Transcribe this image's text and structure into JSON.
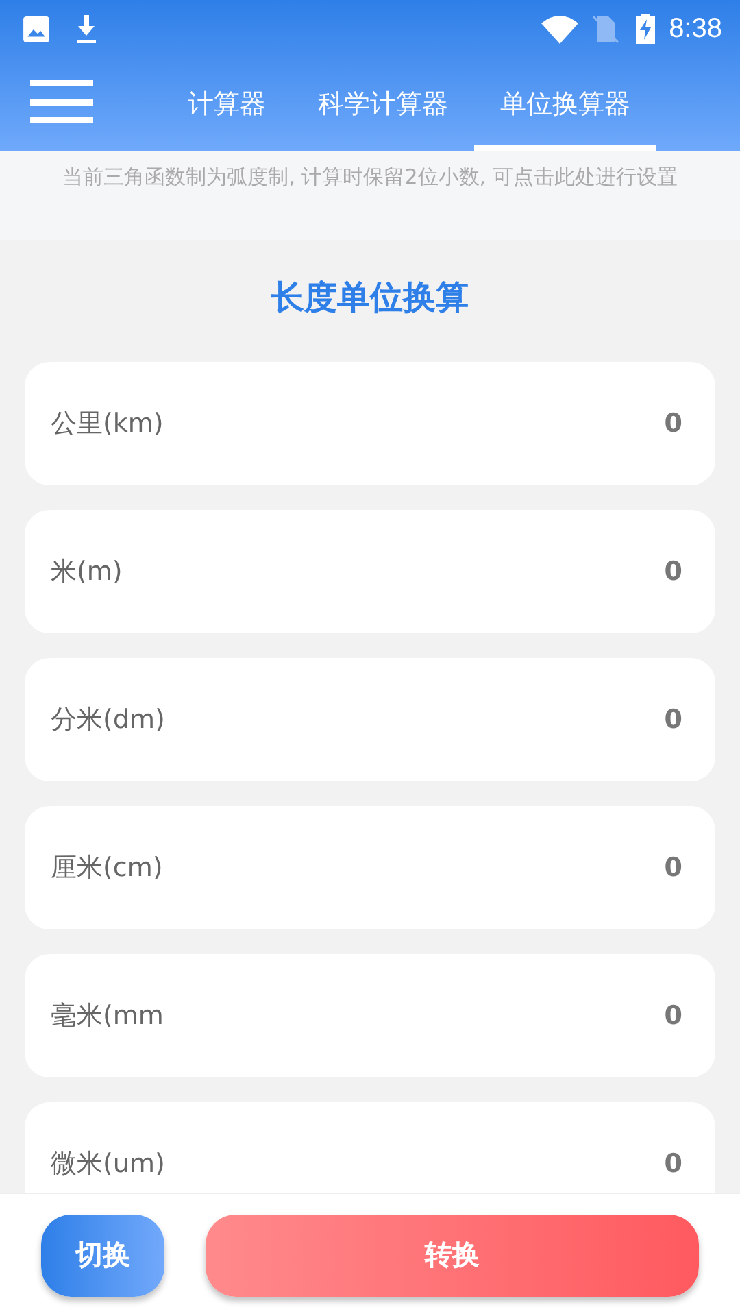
{
  "status_bar": {
    "time": "8:38"
  },
  "tabs": [
    {
      "label": "计算器",
      "selected": false
    },
    {
      "label": "科学计算器",
      "selected": false
    },
    {
      "label": "单位换算器",
      "selected": true
    }
  ],
  "notice": "当前三角函数制为弧度制, 计算时保留2位小数, 可点击此处进行设置",
  "title": "长度单位换算",
  "units": [
    {
      "label": "公里(km)",
      "value": "0"
    },
    {
      "label": "米(m)",
      "value": "0"
    },
    {
      "label": "分米(dm)",
      "value": "0"
    },
    {
      "label": "厘米(cm)",
      "value": "0"
    },
    {
      "label": "毫米(mm",
      "value": "0"
    },
    {
      "label": "微米(um)",
      "value": "0"
    }
  ],
  "buttons": [
    {
      "label": "切换",
      "kind": "switch"
    },
    {
      "label": "转换",
      "kind": "convert"
    }
  ]
}
